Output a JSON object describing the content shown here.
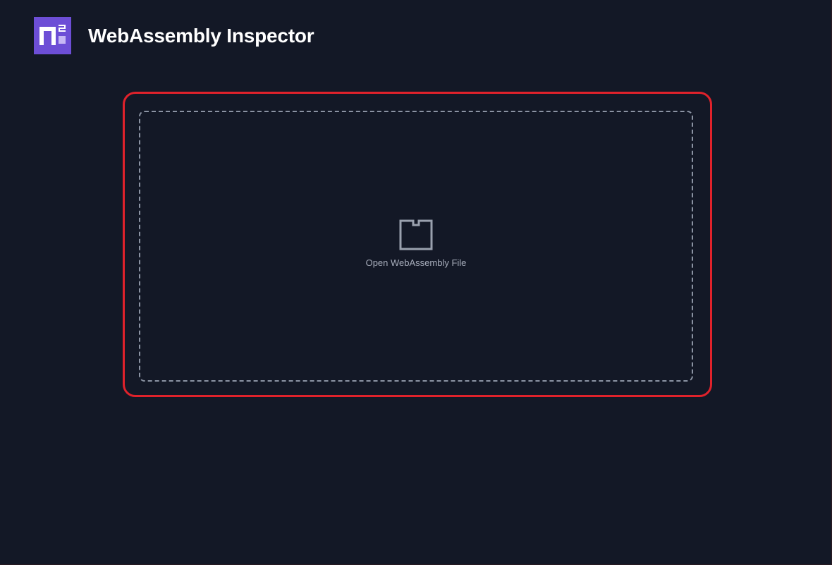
{
  "app": {
    "title": "WebAssembly Inspector",
    "logo_icon": "n2-logo-icon"
  },
  "drop_zone": {
    "label": "Open WebAssembly File",
    "icon": "box-icon",
    "highlighted": true
  },
  "colors": {
    "background": "#131826",
    "logo_purple": "#6d4ed6",
    "highlight_red": "#e0222b",
    "dashed_border": "#8b93a3",
    "label_gray": "#a7adbb"
  }
}
